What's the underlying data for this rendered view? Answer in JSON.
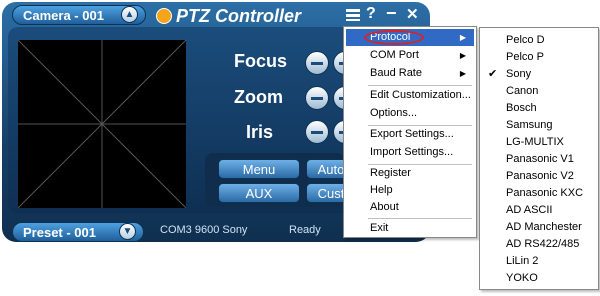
{
  "window": {
    "title": "PTZ Controller",
    "camera_label": "Camera - 001",
    "preset_label": "Preset - 001",
    "status_port": "COM3 9600 Sony",
    "status_state": "Ready",
    "help_glyph": "?",
    "minimize_glyph": "−",
    "close_glyph": "✕"
  },
  "controls": {
    "focus": "Focus",
    "zoom": "Zoom",
    "iris": "Iris",
    "menu_btn": "Menu",
    "aux_btn": "AUX",
    "auto_btn": "Auto",
    "custom_btn": "Cust"
  },
  "menu": {
    "items": [
      {
        "label": "Protocol",
        "submenu": true
      },
      {
        "label": "COM Port",
        "submenu": true
      },
      {
        "label": "Baud Rate",
        "submenu": true
      },
      {
        "label": "Edit Customization..."
      },
      {
        "label": "Options..."
      },
      {
        "label": "Export Settings..."
      },
      {
        "label": "Import Settings..."
      },
      {
        "label": "Register"
      },
      {
        "label": "Help"
      },
      {
        "label": "About"
      },
      {
        "label": "Exit"
      }
    ]
  },
  "protocols": {
    "selected": "Sony",
    "items": [
      "Pelco D",
      "Pelco P",
      "Sony",
      "Canon",
      "Bosch",
      "Samsung",
      "LG-MULTIX",
      "Panasonic V1",
      "Panasonic V2",
      "Panasonic KXC",
      "AD ASCII",
      "AD Manchester",
      "AD RS422/485",
      "LiLin 2",
      "YOKO"
    ]
  },
  "icons": {
    "chevron_up": "chevron-up-icon",
    "chevron_down": "chevron-down-icon",
    "menu_icon": "list-menu-icon",
    "logo": "ptz-logo-icon",
    "check": "checkmark-icon",
    "submenu_arrow": "caret-right-icon"
  },
  "colors": {
    "window_blue": "#1b4d7c",
    "menu_highlight": "#316ac5",
    "annotation_red": "#e02020"
  }
}
